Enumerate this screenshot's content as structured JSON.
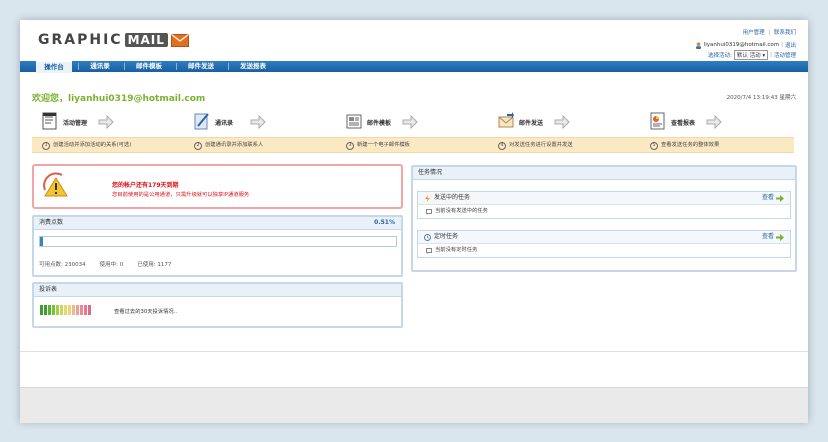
{
  "header": {
    "logo_word": "GRAPHIC",
    "logo_mail": "MAIL",
    "link_user_manage": "用户管理",
    "link_sep": "|",
    "link_contact": "联系我们",
    "user_email": "liyanhui0319@hotmail.com",
    "logout": "退出",
    "campaign_label": "选择活动:",
    "campaign_value": "默认 活动",
    "campaign_manage": "活动管理"
  },
  "nav": {
    "tabs": [
      {
        "label": "操作台"
      },
      {
        "label": "通讯录"
      },
      {
        "label": "邮件模板"
      },
      {
        "label": "邮件发送"
      },
      {
        "label": "发送报表"
      }
    ]
  },
  "welcome": "欢迎您，liyanhui0319@hotmail.com",
  "datetime": "2020/7/4 13:19:43 星期六",
  "steps": [
    {
      "label": "活动管理",
      "num": "1",
      "desc": "创建活动并添加活动的关系(可选)",
      "icon": "edit-doc-icon"
    },
    {
      "label": "通讯录",
      "num": "2",
      "desc": "创建通讯录并添加联系人",
      "icon": "pen-paper-icon"
    },
    {
      "label": "邮件模板",
      "num": "3",
      "desc": "新建一个电子邮件模板",
      "icon": "newspaper-icon"
    },
    {
      "label": "邮件发送",
      "num": "4",
      "desc": "对发送任务进行设置并发送",
      "icon": "envelope-icon"
    },
    {
      "label": "查看报表",
      "num": "5",
      "desc": "查看发送任务的整体效果",
      "icon": "report-icon"
    }
  ],
  "alert": {
    "title": "您的帐户还有179天到期",
    "body": "您目前使用的是公用通道，只需升级就可以独享IP通道服务"
  },
  "credits": {
    "title": "消费点数",
    "percent": "0.51%",
    "percent_value": 0.51,
    "available_label": "可用点数:",
    "available": "230034",
    "in_use_label": "使用中:",
    "in_use": "0",
    "used_label": "已使用:",
    "used": "1177"
  },
  "complaint": {
    "title": "投诉表",
    "text": "查看过去的30天投诉情况..",
    "bar_colors": [
      "#3aa02a",
      "#3aa02a",
      "#5ab42e",
      "#7bc238",
      "#a5cf46",
      "#c8d85a",
      "#e2d96a",
      "#f0d078",
      "#f0b88a",
      "#ee9e98",
      "#ec8a9a",
      "#e87890",
      "#e06a88"
    ]
  },
  "tasks": {
    "title": "任务情况",
    "sending_title": "发送中的任务",
    "sending_view": "查看",
    "sending_empty": "当前没有发送中的任务",
    "timed_title": "定时任务",
    "timed_view": "查看",
    "timed_empty": "当前没有定时任务"
  },
  "colors": {
    "nav_blue": "#1a5fa0",
    "welcome_green": "#7ab22e",
    "alert_red": "#d8141b",
    "steps_bg": "#fbe9c4"
  }
}
